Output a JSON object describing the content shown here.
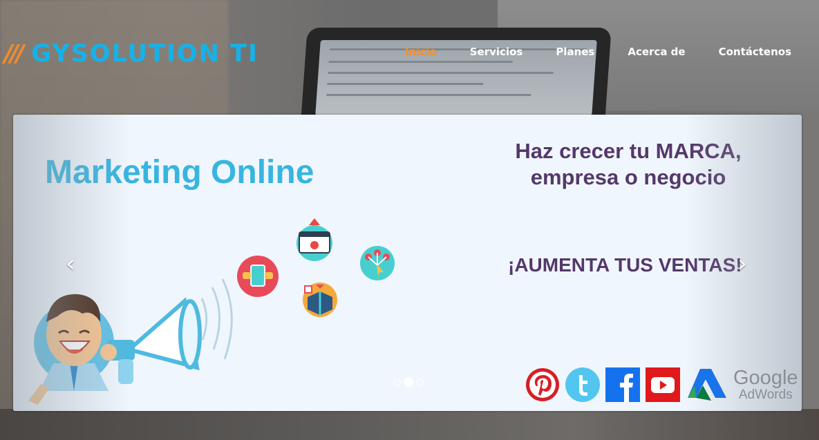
{
  "brand": {
    "slashes": "///",
    "name": "GYSOLUTION TI"
  },
  "nav": [
    {
      "label": "Inicio",
      "active": true
    },
    {
      "label": "Servicios"
    },
    {
      "label": "Planes"
    },
    {
      "label": "Acerca de"
    },
    {
      "label": "Contáctenos"
    }
  ],
  "slide": {
    "headline": "Marketing Online",
    "subhead_line1": "Haz crecer tu MARCA,",
    "subhead_line2": "empresa o negocio",
    "cta": "¡AUMENTA TUS VENTAS!",
    "prev_icon": "‹",
    "next_icon": "›",
    "dots": [
      {
        "active": false
      },
      {
        "active": true
      },
      {
        "active": false
      }
    ],
    "social_icons": [
      "pinterest-icon",
      "twitter-icon",
      "facebook-icon",
      "youtube-icon",
      "google-adwords-icon"
    ],
    "adwords_word1": "Google",
    "adwords_word2": "AdWords"
  },
  "colors": {
    "brand_blue": "#15b2ea",
    "brand_orange": "#f48b2a",
    "nav_active": "#f4902e",
    "headline_blue": "#37b5e0",
    "subhead_purple": "#54386a"
  }
}
